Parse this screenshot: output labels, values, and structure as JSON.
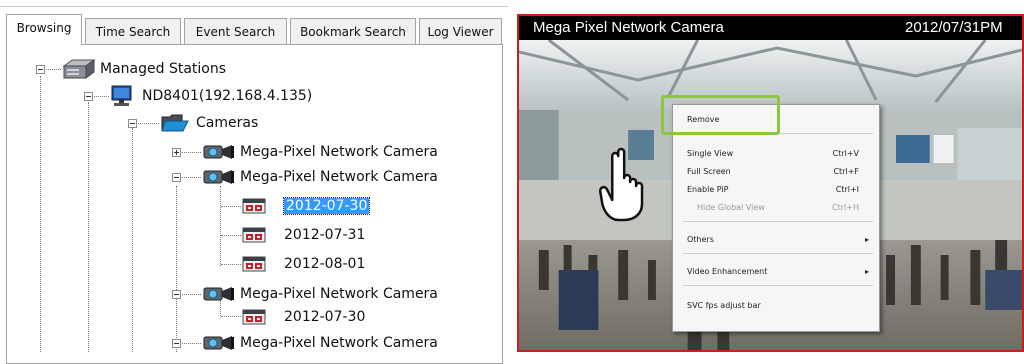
{
  "left_panel": {
    "tabs": [
      {
        "label": "Browsing",
        "active": true
      },
      {
        "label": "Time Search",
        "active": false
      },
      {
        "label": "Event Search",
        "active": false
      },
      {
        "label": "Bookmark Search",
        "active": false
      },
      {
        "label": "Log Viewer",
        "active": false
      }
    ],
    "tree": {
      "root": "Managed Stations",
      "station": "ND8401(192.168.4.135)",
      "cameras_folder": "Cameras",
      "nodes": [
        {
          "label": "Mega-Pixel Network Camera",
          "type": "camera",
          "expand": "plus"
        },
        {
          "label": "Mega-Pixel Network Camera",
          "type": "camera",
          "expand": "minus"
        },
        {
          "label": "2012-07-30",
          "type": "date",
          "selected": true
        },
        {
          "label": "2012-07-31",
          "type": "date"
        },
        {
          "label": "2012-08-01",
          "type": "date"
        },
        {
          "label": "Mega-Pixel Network Camera",
          "type": "camera",
          "expand": "minus"
        },
        {
          "label": "2012-07-30",
          "type": "date"
        },
        {
          "label": "Mega-Pixel Network Camera",
          "type": "camera",
          "expand": "minus"
        }
      ]
    }
  },
  "camera_view": {
    "title": "Mega Pixel Network Camera",
    "timestamp": "2012/07/31PM",
    "border_color": "#cc1c1c",
    "context_menu": {
      "items": [
        {
          "label": "Remove",
          "shortcut": "",
          "enabled": true,
          "highlighted": true
        },
        {
          "label": "Single View",
          "shortcut": "Ctrl+V",
          "enabled": true
        },
        {
          "label": "Full Screen",
          "shortcut": "Ctrl+F",
          "enabled": true
        },
        {
          "label": "Enable PiP",
          "shortcut": "Ctrl+I",
          "enabled": true
        },
        {
          "label": "Hide Global View",
          "shortcut": "Ctrl+H",
          "enabled": false
        },
        {
          "label": "Others",
          "shortcut": "",
          "submenu": true,
          "enabled": true
        },
        {
          "label": "Video Enhancement",
          "shortcut": "",
          "submenu": true,
          "enabled": true
        },
        {
          "label": "SVC fps adjust bar",
          "shortcut": "",
          "enabled": true
        }
      ],
      "highlight_color": "#8dc63f"
    }
  }
}
